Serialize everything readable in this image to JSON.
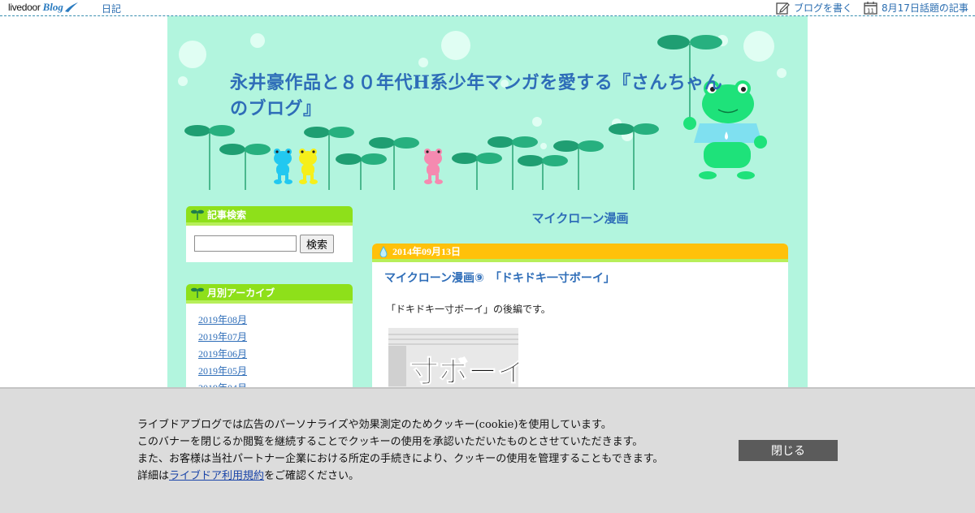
{
  "topbar": {
    "logo_text": "livedoor",
    "logo_blog": "Blog",
    "nikki": "日記",
    "write_blog": "ブログを書く",
    "calendar_day": "11",
    "topic_articles": "8月17日話題の記事"
  },
  "blog": {
    "title": "永井豪作品と８０年代H系少年マンガを愛する『さんちゃんのブログ』"
  },
  "sidebar": {
    "search": {
      "heading": "記事検索",
      "placeholder": "",
      "button": "検索"
    },
    "archive": {
      "heading": "月別アーカイブ",
      "items": [
        "2019年08月",
        "2019年07月",
        "2019年06月",
        "2019年05月",
        "2019年04月"
      ]
    }
  },
  "main": {
    "category_title": "マイクローン漫画",
    "article": {
      "date": "2014年09月13日",
      "title": "マイクローン漫画⑨　「ドキドキ一寸ボーイ」",
      "text": "「ドキドキ一寸ボーイ」の後編です。",
      "image_text": "寸ボーイ"
    }
  },
  "cookie": {
    "line1": "ライブドアブログでは広告のパーソナライズや効果測定のためクッキー(cookie)を使用しています。",
    "line2": "このバナーを閉じるか閲覧を継続することでクッキーの使用を承認いただいたものとさせていただきます。",
    "line3": "また、お客様は当社パートナー企業における所定の手続きにより、クッキーの使用を管理することもできます。",
    "line4_prefix": "詳細は",
    "line4_link": "ライブドア利用規約",
    "line4_suffix": "をご確認ください。",
    "close": "閉じる"
  },
  "colors": {
    "header_bg": "#b2f5de",
    "title": "#2e6db8",
    "widget_head": "#8ee01a",
    "date_bar": "#ffc10a",
    "banner_bg": "#dcdcdc",
    "close_btn": "#5b5b5b"
  }
}
